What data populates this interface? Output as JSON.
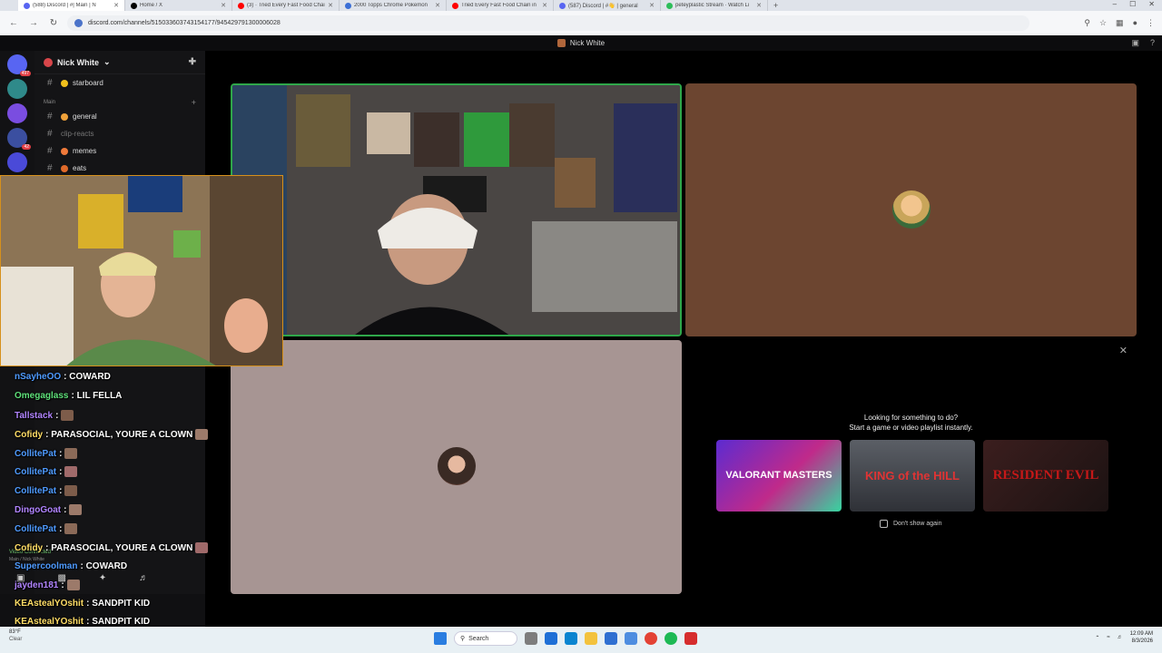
{
  "browser": {
    "tabs": [
      {
        "label": "(588) Discord | #| Main | N",
        "color": "#5865f2",
        "active": true
      },
      {
        "label": "Home / X",
        "color": "#000000",
        "active": false
      },
      {
        "label": "(3) · Tried Every Fast Food Chai",
        "color": "#ff0000",
        "active": false
      },
      {
        "label": "2000 Topps Chrome Pokemon",
        "color": "#3b6fd6",
        "active": false
      },
      {
        "label": "Tried Every Fast Food Chain in",
        "color": "#ff0000",
        "active": false
      },
      {
        "label": "(587) Discord | #👋 | general",
        "color": "#5865f2",
        "active": false
      },
      {
        "label": "peteyplastic Stream · Watch Li",
        "color": "#2dbd5a",
        "active": false
      }
    ],
    "new_tab": "+",
    "window_controls": [
      "–",
      "☐",
      "✕"
    ],
    "url": "discord.com/channels/515033603743154177/945429791300006028",
    "back": "←",
    "forward": "→",
    "reload": "↻"
  },
  "discord": {
    "call_title": "Nick White",
    "guild_name": "Nick White",
    "category_main": "Main",
    "channels": [
      {
        "label": "starboard",
        "emoji_color": "#f2c01c"
      },
      {
        "label": "general",
        "emoji_color": "#f0a23a"
      },
      {
        "label": "clip-reacts",
        "emoji_color": "#666666",
        "dim": true
      },
      {
        "label": "memes",
        "emoji_color": "#f07a3a"
      },
      {
        "label": "eats",
        "emoji_color": "#e06a2a"
      }
    ],
    "rail_badges": [
      "497",
      "42"
    ],
    "voice_status": "Video Connected",
    "voice_channel": "Main / Nick White"
  },
  "activity_panel": {
    "heading_line1": "Looking for something to do?",
    "heading_line2": "Start a game or video playlist instantly.",
    "cards": [
      {
        "title": "VALORANT MASTERS"
      },
      {
        "title": "KING of the HILL"
      },
      {
        "title": "RESIDENT EVIL"
      }
    ],
    "dont_show": "Don't show again",
    "close": "✕"
  },
  "chat": [
    {
      "name": "nSayheOO",
      "text": " : COWARD",
      "color": "#4f9bff"
    },
    {
      "name": "Omegaglass",
      "text": " : LIL FELLA",
      "color": "#5fe07a"
    },
    {
      "name": "Tallstack",
      "text": " :",
      "color": "#b184ff",
      "emote": true
    },
    {
      "name": "Cofidy",
      "text": " : PARASOCIAL, YOURE A CLOWN",
      "color": "#ffdd66",
      "emote": true
    },
    {
      "name": "CollitePat",
      "text": " :",
      "color": "#4f9bff",
      "emote": true
    },
    {
      "name": "CollitePat",
      "text": " :",
      "color": "#4f9bff",
      "emote": true
    },
    {
      "name": "CollitePat",
      "text": " :",
      "color": "#4f9bff",
      "emote": true
    },
    {
      "name": "DingoGoat",
      "text": " :",
      "color": "#b184ff",
      "emote": true
    },
    {
      "name": "CollitePat",
      "text": " :",
      "color": "#4f9bff",
      "emote": true
    },
    {
      "name": "Cofidy",
      "text": " : PARASOCIAL, YOURE A CLOWN",
      "color": "#ffdd66",
      "emote": true
    },
    {
      "name": "Supercoolman",
      "text": " : COWARD",
      "color": "#4f9bff"
    },
    {
      "name": "jayden181",
      "text": " :",
      "color": "#b184ff",
      "emote": true
    },
    {
      "name": "KEAstealYOshit",
      "text": " : SANDPIT KID",
      "color": "#ffdd66"
    },
    {
      "name": "KEAstealYOshit",
      "text": " : SANDPIT KID",
      "color": "#ffdd66"
    }
  ],
  "taskbar": {
    "weather_temp": "83°F",
    "weather_desc": "Clear",
    "search": "Search",
    "time": "12:09 AM",
    "date": "8/3/2026"
  }
}
